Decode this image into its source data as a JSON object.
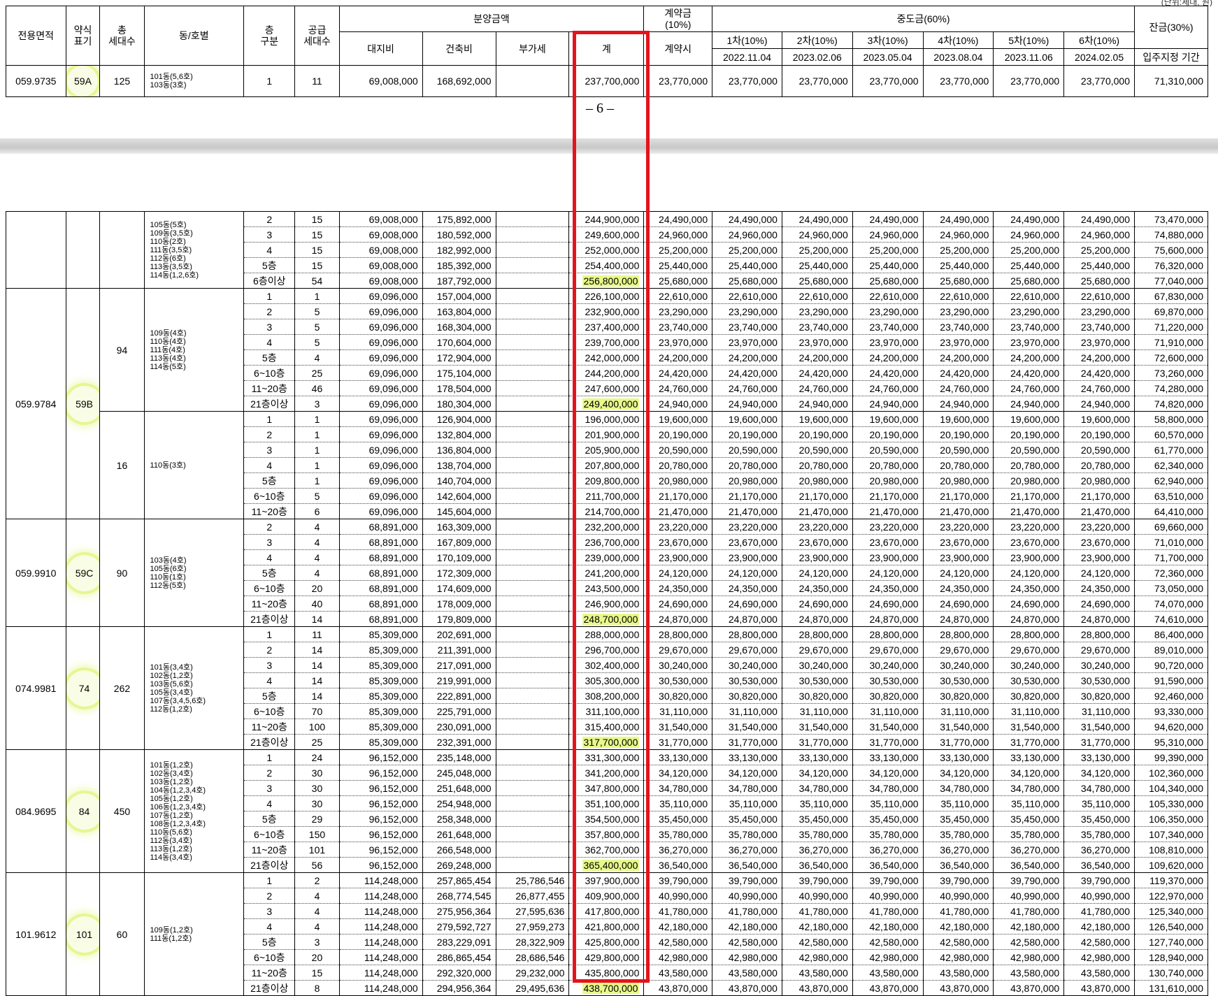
{
  "header": {
    "area": "전용면적",
    "type_mark": "약식\n표기",
    "households": "총\n세대수",
    "dong_ho": "동/호별",
    "floor": "층\n구분",
    "supply": "공급\n세대수",
    "price_group": "분양금액",
    "land": "대지비",
    "building": "건축비",
    "vat": "부가세",
    "total": "계",
    "deposit_group": "계약금\n(10%)",
    "deposit_when": "계약시",
    "interim_group": "중도금(60%)",
    "interim": [
      {
        "label": "1차(10%)",
        "date": "2022.11.04"
      },
      {
        "label": "2차(10%)",
        "date": "2023.02.06"
      },
      {
        "label": "3차(10%)",
        "date": "2023.05.04"
      },
      {
        "label": "4차(10%)",
        "date": "2023.08.04"
      },
      {
        "label": "5차(10%)",
        "date": "2023.11.06"
      },
      {
        "label": "6차(10%)",
        "date": "2024.02.05"
      }
    ],
    "balance_group": "잔금(30%)",
    "balance_when": "입주지정 기간"
  },
  "unit_note_fragment": "(단위:세대, 원)",
  "page_number": "– 6 –",
  "first_row": {
    "area": "059.9735",
    "mark": "59A",
    "households": "125",
    "dong": "101동(5,6호)\n103동(3호)",
    "floor": "1",
    "supply": "11",
    "land": "69,008,000",
    "building": "168,692,000",
    "vat": "",
    "total": "237,700,000",
    "deposit": "23,770,000",
    "interim": "23,770,000",
    "balance": "71,310,000"
  },
  "groups": [
    {
      "area": "",
      "mark": "",
      "households": "",
      "circle": false,
      "subgroups": [
        {
          "households": "",
          "dong": "105동(5호)\n109동(3,5호)\n110동(2호)\n111동(3,5호)\n112동(6호)\n113동(3,5호)\n114동(1,2,6호)",
          "rows": [
            [
              "2",
              "15",
              "69,008,000",
              "175,892,000",
              "",
              "244,900,000",
              "24,490,000",
              "24,490,000",
              "73,470,000"
            ],
            [
              "3",
              "15",
              "69,008,000",
              "180,592,000",
              "",
              "249,600,000",
              "24,960,000",
              "24,960,000",
              "74,880,000"
            ],
            [
              "4",
              "15",
              "69,008,000",
              "182,992,000",
              "",
              "252,000,000",
              "25,200,000",
              "25,200,000",
              "75,600,000"
            ],
            [
              "5층",
              "15",
              "69,008,000",
              "185,392,000",
              "",
              "254,400,000",
              "25,440,000",
              "25,440,000",
              "76,320,000"
            ],
            [
              "6층이상",
              "54",
              "69,008,000",
              "187,792,000",
              "",
              "256,800,000",
              "25,680,000",
              "25,680,000",
              "77,040,000"
            ]
          ]
        }
      ]
    },
    {
      "area": "059.9784",
      "mark": "59B",
      "circle": true,
      "subgroups": [
        {
          "households": "94",
          "dong": "109동(4호)\n110동(4호)\n111동(4호)\n113동(4호)\n114동(5호)",
          "rows": [
            [
              "1",
              "1",
              "69,096,000",
              "157,004,000",
              "",
              "226,100,000",
              "22,610,000",
              "22,610,000",
              "67,830,000"
            ],
            [
              "2",
              "5",
              "69,096,000",
              "163,804,000",
              "",
              "232,900,000",
              "23,290,000",
              "23,290,000",
              "69,870,000"
            ],
            [
              "3",
              "5",
              "69,096,000",
              "168,304,000",
              "",
              "237,400,000",
              "23,740,000",
              "23,740,000",
              "71,220,000"
            ],
            [
              "4",
              "5",
              "69,096,000",
              "170,604,000",
              "",
              "239,700,000",
              "23,970,000",
              "23,970,000",
              "71,910,000"
            ],
            [
              "5층",
              "4",
              "69,096,000",
              "172,904,000",
              "",
              "242,000,000",
              "24,200,000",
              "24,200,000",
              "72,600,000"
            ],
            [
              "6~10층",
              "25",
              "69,096,000",
              "175,104,000",
              "",
              "244,200,000",
              "24,420,000",
              "24,420,000",
              "73,260,000"
            ],
            [
              "11~20층",
              "46",
              "69,096,000",
              "178,504,000",
              "",
              "247,600,000",
              "24,760,000",
              "24,760,000",
              "74,280,000"
            ],
            [
              "21층이상",
              "3",
              "69,096,000",
              "180,304,000",
              "",
              "249,400,000",
              "24,940,000",
              "24,940,000",
              "74,820,000"
            ]
          ]
        },
        {
          "households": "16",
          "dong": "110동(3호)",
          "rows": [
            [
              "1",
              "1",
              "69,096,000",
              "126,904,000",
              "",
              "196,000,000",
              "19,600,000",
              "19,600,000",
              "58,800,000"
            ],
            [
              "2",
              "1",
              "69,096,000",
              "132,804,000",
              "",
              "201,900,000",
              "20,190,000",
              "20,190,000",
              "60,570,000"
            ],
            [
              "3",
              "1",
              "69,096,000",
              "136,804,000",
              "",
              "205,900,000",
              "20,590,000",
              "20,590,000",
              "61,770,000"
            ],
            [
              "4",
              "1",
              "69,096,000",
              "138,704,000",
              "",
              "207,800,000",
              "20,780,000",
              "20,780,000",
              "62,340,000"
            ],
            [
              "5층",
              "1",
              "69,096,000",
              "140,704,000",
              "",
              "209,800,000",
              "20,980,000",
              "20,980,000",
              "62,940,000"
            ],
            [
              "6~10층",
              "5",
              "69,096,000",
              "142,604,000",
              "",
              "211,700,000",
              "21,170,000",
              "21,170,000",
              "63,510,000"
            ],
            [
              "11~20층",
              "6",
              "69,096,000",
              "145,604,000",
              "",
              "214,700,000",
              "21,470,000",
              "21,470,000",
              "64,410,000"
            ]
          ]
        }
      ]
    },
    {
      "area": "059.9910",
      "mark": "59C",
      "circle": true,
      "subgroups": [
        {
          "households": "90",
          "dong": "103동(4호)\n105동(6호)\n110동(1호)\n112동(5호)",
          "rows": [
            [
              "2",
              "4",
              "68,891,000",
              "163,309,000",
              "",
              "232,200,000",
              "23,220,000",
              "23,220,000",
              "69,660,000"
            ],
            [
              "3",
              "4",
              "68,891,000",
              "167,809,000",
              "",
              "236,700,000",
              "23,670,000",
              "23,670,000",
              "71,010,000"
            ],
            [
              "4",
              "4",
              "68,891,000",
              "170,109,000",
              "",
              "239,000,000",
              "23,900,000",
              "23,900,000",
              "71,700,000"
            ],
            [
              "5층",
              "4",
              "68,891,000",
              "172,309,000",
              "",
              "241,200,000",
              "24,120,000",
              "24,120,000",
              "72,360,000"
            ],
            [
              "6~10층",
              "20",
              "68,891,000",
              "174,609,000",
              "",
              "243,500,000",
              "24,350,000",
              "24,350,000",
              "73,050,000"
            ],
            [
              "11~20층",
              "40",
              "68,891,000",
              "178,009,000",
              "",
              "246,900,000",
              "24,690,000",
              "24,690,000",
              "74,070,000"
            ],
            [
              "21층이상",
              "14",
              "68,891,000",
              "179,809,000",
              "",
              "248,700,000",
              "24,870,000",
              "24,870,000",
              "74,610,000"
            ]
          ]
        }
      ]
    },
    {
      "area": "074.9981",
      "mark": "74",
      "circle": true,
      "subgroups": [
        {
          "households": "262",
          "dong": "101동(3,4호)\n102동(1,2호)\n103동(5,6호)\n105동(3,4호)\n107동(3,4,5,6호)\n112동(1,2호)",
          "rows": [
            [
              "1",
              "11",
              "85,309,000",
              "202,691,000",
              "",
              "288,000,000",
              "28,800,000",
              "28,800,000",
              "86,400,000"
            ],
            [
              "2",
              "14",
              "85,309,000",
              "211,391,000",
              "",
              "296,700,000",
              "29,670,000",
              "29,670,000",
              "89,010,000"
            ],
            [
              "3",
              "14",
              "85,309,000",
              "217,091,000",
              "",
              "302,400,000",
              "30,240,000",
              "30,240,000",
              "90,720,000"
            ],
            [
              "4",
              "14",
              "85,309,000",
              "219,991,000",
              "",
              "305,300,000",
              "30,530,000",
              "30,530,000",
              "91,590,000"
            ],
            [
              "5층",
              "14",
              "85,309,000",
              "222,891,000",
              "",
              "308,200,000",
              "30,820,000",
              "30,820,000",
              "92,460,000"
            ],
            [
              "6~10층",
              "70",
              "85,309,000",
              "225,791,000",
              "",
              "311,100,000",
              "31,110,000",
              "31,110,000",
              "93,330,000"
            ],
            [
              "11~20층",
              "100",
              "85,309,000",
              "230,091,000",
              "",
              "315,400,000",
              "31,540,000",
              "31,540,000",
              "94,620,000"
            ],
            [
              "21층이상",
              "25",
              "85,309,000",
              "232,391,000",
              "",
              "317,700,000",
              "31,770,000",
              "31,770,000",
              "95,310,000"
            ]
          ]
        }
      ]
    },
    {
      "area": "084.9695",
      "mark": "84",
      "circle": true,
      "subgroups": [
        {
          "households": "450",
          "dong": "101동(1,2호)\n102동(3,4호)\n103동(1,2호)\n104동(1,2,3,4호)\n105동(1,2호)\n106동(1,2,3,4호)\n107동(1,2호)\n108동(1,2,3,4호)\n110동(5,6호)\n112동(3,4호)\n113동(1,2호)\n114동(3,4호)",
          "rows": [
            [
              "1",
              "24",
              "96,152,000",
              "235,148,000",
              "",
              "331,300,000",
              "33,130,000",
              "33,130,000",
              "99,390,000"
            ],
            [
              "2",
              "30",
              "96,152,000",
              "245,048,000",
              "",
              "341,200,000",
              "34,120,000",
              "34,120,000",
              "102,360,000"
            ],
            [
              "3",
              "30",
              "96,152,000",
              "251,648,000",
              "",
              "347,800,000",
              "34,780,000",
              "34,780,000",
              "104,340,000"
            ],
            [
              "4",
              "30",
              "96,152,000",
              "254,948,000",
              "",
              "351,100,000",
              "35,110,000",
              "35,110,000",
              "105,330,000"
            ],
            [
              "5층",
              "29",
              "96,152,000",
              "258,348,000",
              "",
              "354,500,000",
              "35,450,000",
              "35,450,000",
              "106,350,000"
            ],
            [
              "6~10층",
              "150",
              "96,152,000",
              "261,648,000",
              "",
              "357,800,000",
              "35,780,000",
              "35,780,000",
              "107,340,000"
            ],
            [
              "11~20층",
              "101",
              "96,152,000",
              "266,548,000",
              "",
              "362,700,000",
              "36,270,000",
              "36,270,000",
              "108,810,000"
            ],
            [
              "21층이상",
              "56",
              "96,152,000",
              "269,248,000",
              "",
              "365,400,000",
              "36,540,000",
              "36,540,000",
              "109,620,000"
            ]
          ]
        }
      ]
    },
    {
      "area": "101.9612",
      "mark": "101",
      "circle": true,
      "subgroups": [
        {
          "households": "60",
          "dong": "109동(1,2호)\n111동(1,2호)",
          "rows": [
            [
              "1",
              "2",
              "114,248,000",
              "257,865,454",
              "25,786,546",
              "397,900,000",
              "39,790,000",
              "39,790,000",
              "119,370,000"
            ],
            [
              "2",
              "4",
              "114,248,000",
              "268,774,545",
              "26,877,455",
              "409,900,000",
              "40,990,000",
              "40,990,000",
              "122,970,000"
            ],
            [
              "3",
              "4",
              "114,248,000",
              "275,956,364",
              "27,595,636",
              "417,800,000",
              "41,780,000",
              "41,780,000",
              "125,340,000"
            ],
            [
              "4",
              "4",
              "114,248,000",
              "279,592,727",
              "27,959,273",
              "421,800,000",
              "42,180,000",
              "42,180,000",
              "126,540,000"
            ],
            [
              "5층",
              "3",
              "114,248,000",
              "283,229,091",
              "28,322,909",
              "425,800,000",
              "42,580,000",
              "42,580,000",
              "127,740,000"
            ],
            [
              "6~10층",
              "20",
              "114,248,000",
              "286,865,454",
              "28,686,546",
              "429,800,000",
              "42,980,000",
              "42,980,000",
              "128,940,000"
            ],
            [
              "11~20층",
              "15",
              "114,248,000",
              "292,320,000",
              "29,232,000",
              "435,800,000",
              "43,580,000",
              "43,580,000",
              "130,740,000"
            ],
            [
              "21층이상",
              "8",
              "114,248,000",
              "294,956,364",
              "29,495,636",
              "438,700,000",
              "43,870,000",
              "43,870,000",
              "131,610,000"
            ]
          ]
        }
      ]
    }
  ],
  "colors": {
    "highlight": "#e8f98a",
    "red_box": "#e3141c"
  }
}
